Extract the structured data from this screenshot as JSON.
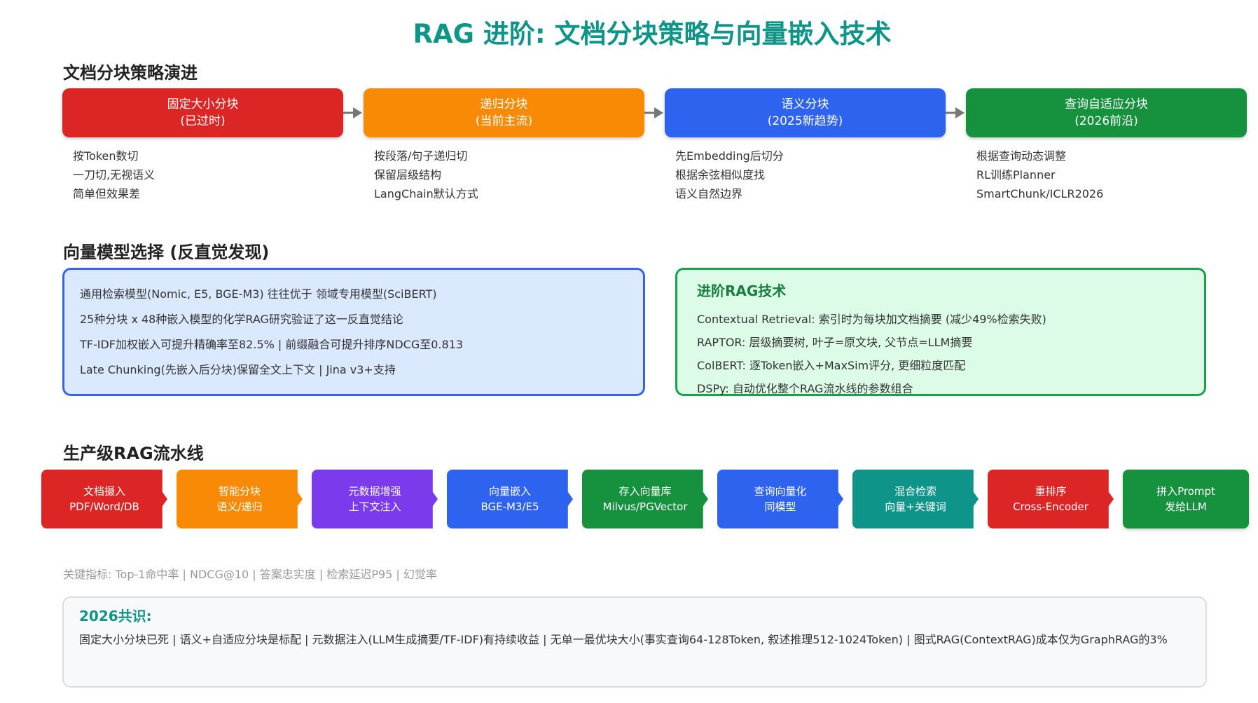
{
  "title": "RAG 进阶: 文档分块策略与向量嵌入技术",
  "chunking": {
    "heading": "文档分块策略演进",
    "stages": [
      {
        "name": "固定大小分块",
        "note": "(已过时)",
        "color": "#dc2626",
        "desc": [
          "按Token数切",
          "一刀切,无视语义",
          "简单但效果差"
        ]
      },
      {
        "name": "递归分块",
        "note": "(当前主流)",
        "color": "#f98a06",
        "desc": [
          "按段落/句子递归切",
          "保留层级结构",
          "LangChain默认方式"
        ]
      },
      {
        "name": "语义分块",
        "note": "(2025新趋势)",
        "color": "#2e63f0",
        "desc": [
          "先Embedding后切分",
          "根据余弦相似度找",
          "语义自然边界"
        ]
      },
      {
        "name": "查询自适应分块",
        "note": "(2026前沿)",
        "color": "#16913e",
        "desc": [
          "根据查询动态调整",
          "RL训练Planner",
          "SmartChunk/ICLR2026"
        ]
      }
    ]
  },
  "models": {
    "heading": "向量模型选择 (反直觉发现)",
    "findings": [
      "通用检索模型(Nomic, E5, BGE-M3) 往往优于 领域专用模型(SciBERT)",
      "25种分块 x 48种嵌入模型的化学RAG研究验证了这一反直觉结论",
      "TF-IDF加权嵌入可提升精确率至82.5% | 前缀融合可提升排序NDCG至0.813",
      "Late Chunking(先嵌入后分块)保留全文上下文 | Jina v3+支持"
    ],
    "advanced": {
      "title": "进阶RAG技术",
      "items": [
        "Contextual Retrieval: 索引时为每块加文档摘要 (减少49%检索失败)",
        "RAPTOR: 层级摘要树, 叶子=原文块, 父节点=LLM摘要",
        "ColBERT: 逐Token嵌入+MaxSim评分, 更细粒度匹配",
        "DSPy: 自动优化整个RAG流水线的参数组合"
      ]
    }
  },
  "pipeline": {
    "heading": "生产级RAG流水线",
    "steps": [
      {
        "name": "文档摄入",
        "detail": "PDF/Word/DB",
        "color": "#dc2626"
      },
      {
        "name": "智能分块",
        "detail": "语义/递归",
        "color": "#f98a06"
      },
      {
        "name": "元数据增强",
        "detail": "上下文注入",
        "color": "#7c3aed"
      },
      {
        "name": "向量嵌入",
        "detail": "BGE-M3/E5",
        "color": "#2e63f0"
      },
      {
        "name": "存入向量库",
        "detail": "Milvus/PGVector",
        "color": "#16913e"
      },
      {
        "name": "查询向量化",
        "detail": "同模型",
        "color": "#2e63f0"
      },
      {
        "name": "混合检索",
        "detail": "向量+关键词",
        "color": "#0e9488"
      },
      {
        "name": "重排序",
        "detail": "Cross-Encoder",
        "color": "#dc2626"
      },
      {
        "name": "拼入Prompt",
        "detail": "发给LLM",
        "color": "#16913e"
      }
    ]
  },
  "metrics": "关键指标: Top-1命中率 | NDCG@10 | 答案忠实度 | 检索延迟P95 | 幻觉率",
  "consensus": {
    "title": "2026共识:",
    "text": "固定大小分块已死 | 语义+自适应分块是标配 | 元数据注入(LLM生成摘要/TF-IDF)有持续收益 | 无单一最优块大小(事实查询64-128Token, 叙述推理512-1024Token) | 图式RAG(ContextRAG)成本仅为GraphRAG的3%"
  }
}
